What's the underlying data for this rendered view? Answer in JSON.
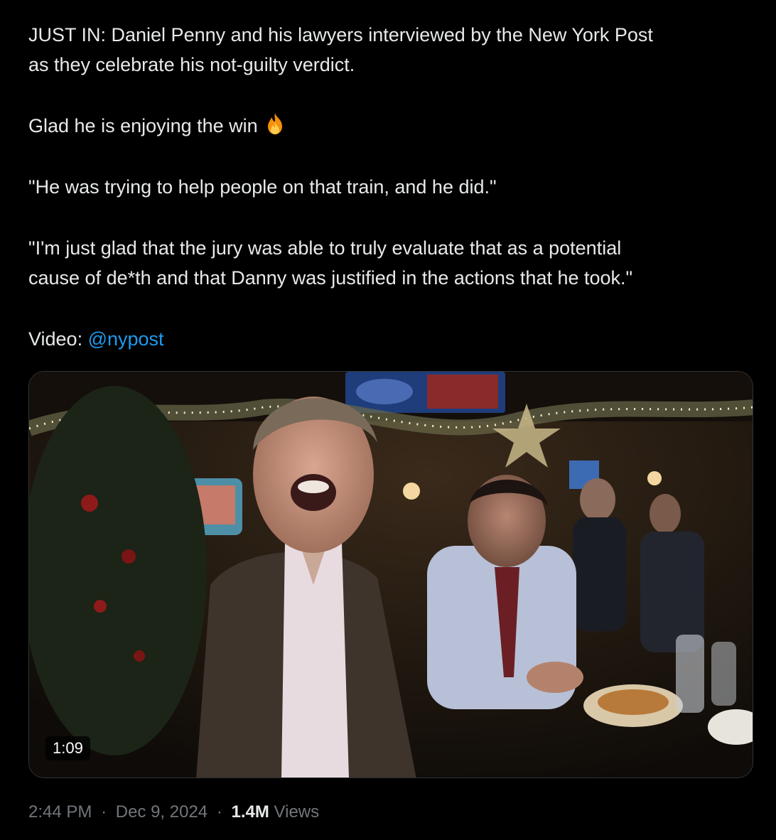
{
  "tweet": {
    "line1": "JUST IN: Daniel Penny and his lawyers interviewed by the New York Post",
    "line2": "as they celebrate his not-guilty verdict.",
    "line3": "Glad he is enjoying the win",
    "emoji": "fire-emoji",
    "line4": "\"He was trying to help people on that train, and he did.\"",
    "line5": "\"I'm just glad that the jury was able to truly evaluate that as a potential",
    "line6": "cause of de*th and that Danny was justified in the actions that he took.\"",
    "video_prefix": "Video:",
    "mention": "@nypost"
  },
  "media": {
    "duration": "1:09"
  },
  "meta": {
    "time": "2:44 PM",
    "separator": "·",
    "date": "Dec 9, 2024",
    "views_count": "1.4M",
    "views_label": "Views"
  },
  "colors": {
    "background": "#000000",
    "text": "#e7e9ea",
    "link": "#1d9bf0",
    "muted": "#71767b"
  }
}
